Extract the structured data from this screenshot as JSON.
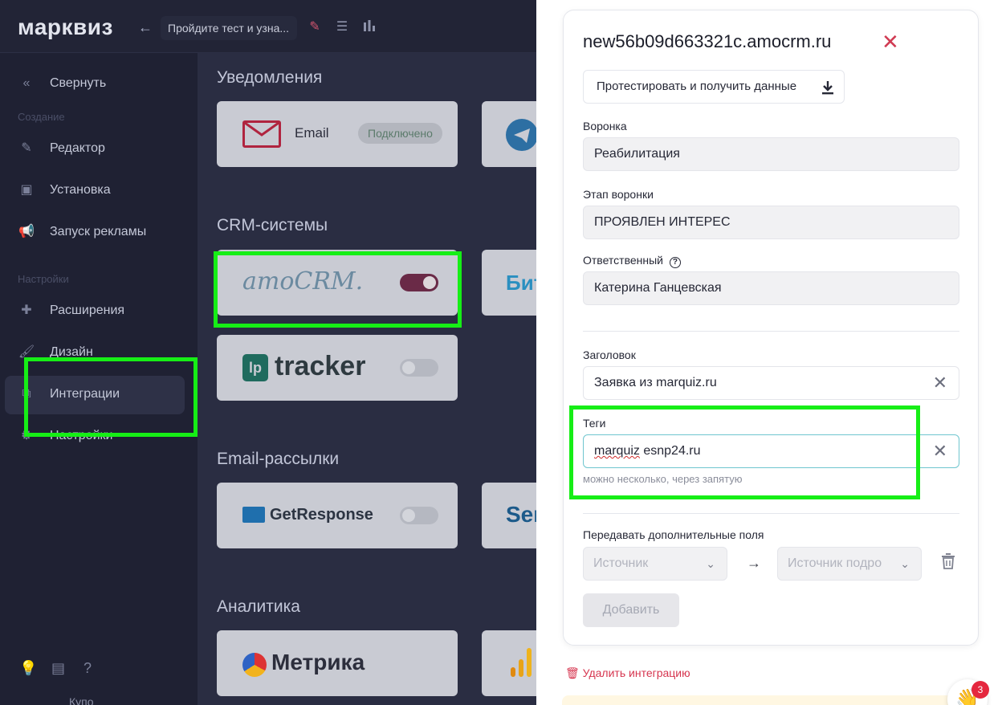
{
  "topbar": {
    "logo": "марквиз",
    "back_icon": "arrow-left-icon",
    "quiz_title": "Пройдите тест и узна...",
    "icons": [
      "pencil-icon",
      "list-icon",
      "bar-chart-icon"
    ]
  },
  "sidebar": {
    "collapse_label": "Свернуть",
    "section_create": "Создание",
    "section_settings": "Настройки",
    "items": [
      {
        "label": "Редактор",
        "icon": "pencil-icon"
      },
      {
        "label": "Установка",
        "icon": "install-icon"
      },
      {
        "label": "Запуск рекламы",
        "icon": "megaphone-icon"
      },
      {
        "label": "Расширения",
        "icon": "puzzle-icon"
      },
      {
        "label": "Дизайн",
        "icon": "brush-icon"
      },
      {
        "label": "Интеграции",
        "icon": "integrations-icon",
        "active": true
      },
      {
        "label": "Настройки",
        "icon": "gear-icon"
      }
    ],
    "bottom_icons": [
      "lightbulb-icon",
      "folder-upload-icon",
      "help-icon"
    ],
    "user_partial": "Купо"
  },
  "content": {
    "sections": {
      "notifications": "Уведомления",
      "crm": "CRM-системы",
      "email": "Email-рассылки",
      "analytics": "Аналитика"
    },
    "cards": {
      "email_label": "Email",
      "email_badge": "Подключено",
      "amocrm_logo": "amoCRM.",
      "bitrix_partial": "Бит",
      "tracker_logo": "tracker",
      "getresponse_logo": "GetResponse",
      "sendpulse_partial": "Sen",
      "metrika_logo": "Метрика"
    }
  },
  "panel": {
    "title": "new56b09d663321c.amocrm.ru",
    "test_button": "Протестировать и получить данные",
    "funnel_label": "Воронка",
    "funnel_value": "Реабилитация",
    "stage_label": "Этап воронки",
    "stage_value": "ПРОЯВЛЕН ИНТЕРЕС",
    "responsible_label": "Ответственный",
    "responsible_value": "Катерина Ганцевская",
    "subject_label": "Заголовок",
    "subject_value": "Заявка из marquiz.ru",
    "tags_label": "Теги",
    "tags_value_word1": "marquiz",
    "tags_value_rest": " esnp24.ru",
    "tags_hint": "можно несколько, через запятую",
    "extra_fields_label": "Передавать дополнительные поля",
    "source_placeholder": "Источник",
    "source_detail_placeholder": "Источник подро",
    "add_button": "Добавить",
    "delete_link": "Удалить интеграцию"
  },
  "chat": {
    "count": "3"
  },
  "colors": {
    "highlight": "#16ee16",
    "accent_red": "#d03a52",
    "dim_bg": "#1f2133"
  }
}
